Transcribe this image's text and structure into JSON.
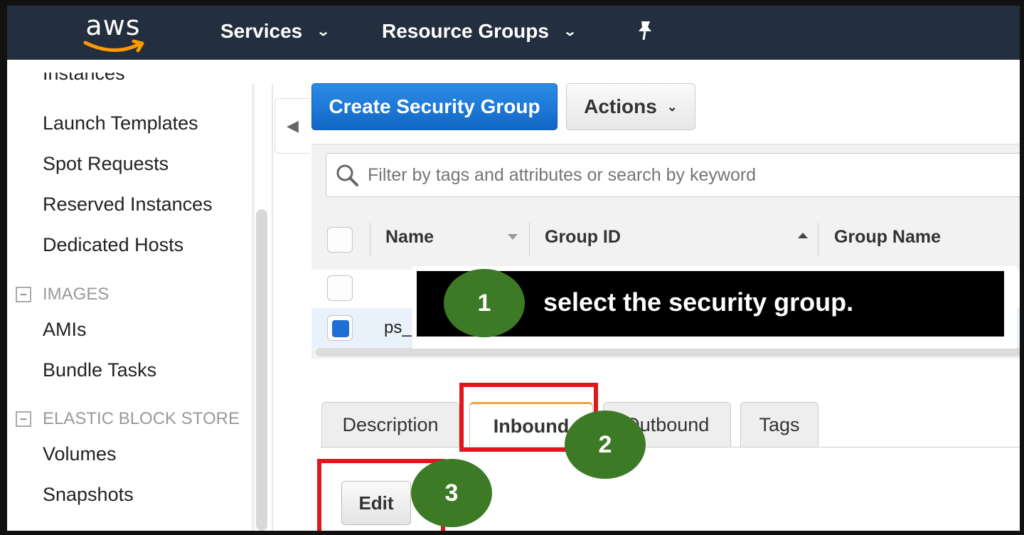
{
  "nav": {
    "logo": "aws",
    "services": "Services",
    "resource_groups": "Resource Groups"
  },
  "sidebar": {
    "items": [
      {
        "label": "Instances"
      },
      {
        "label": "Launch Templates"
      },
      {
        "label": "Spot Requests"
      },
      {
        "label": "Reserved Instances"
      },
      {
        "label": "Dedicated Hosts"
      },
      {
        "label": "AMIs"
      },
      {
        "label": "Bundle Tasks"
      },
      {
        "label": "Volumes"
      },
      {
        "label": "Snapshots"
      }
    ],
    "sections": [
      {
        "label": "IMAGES",
        "toggle": "−"
      },
      {
        "label": "ELASTIC BLOCK STORE",
        "toggle": "−"
      }
    ]
  },
  "toolbar": {
    "create_label": "Create Security Group",
    "actions_label": "Actions"
  },
  "search": {
    "placeholder": "Filter by tags and attributes or search by keyword"
  },
  "table": {
    "columns": [
      "Name",
      "Group ID",
      "Group Name"
    ],
    "rows": [
      {
        "name": "",
        "selected": false
      },
      {
        "name": "ps_",
        "selected": true
      }
    ]
  },
  "tabs": [
    "Description",
    "Inbound",
    "Outbound",
    "Tags"
  ],
  "active_tab": "Inbound",
  "edit_label": "Edit",
  "annotations": {
    "step1": "1",
    "step1_text": "select the security group.",
    "step2": "2",
    "step3": "3"
  },
  "colors": {
    "nav_bg": "#232f3e",
    "primary": "#1f76d3",
    "step_green": "#3d7a26",
    "highlight_red": "#e0161d",
    "active_tab_accent": "#e9a53a"
  }
}
